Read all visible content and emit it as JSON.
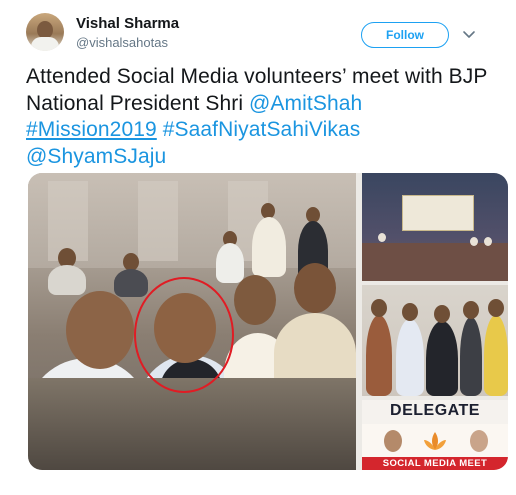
{
  "author": {
    "name": "Vishal Sharma",
    "handle": "@vishalsahotas",
    "avatar_icon": "profile-photo-icon"
  },
  "follow_button": {
    "label": "Follow"
  },
  "menu_caret": {
    "icon": "chevron-down-icon"
  },
  "tweet": {
    "text_plain": "Attended Social Media volunteers’ meet with BJP National President Shri ",
    "mention_1": "@AmitShah",
    "hashtag_1": "#Mission2019",
    "hashtag_2": "#SaafNiyatSahiVikas",
    "mention_2": "@ShyamSJaju"
  },
  "media": {
    "photos": [
      {
        "id": "group-selfie",
        "description_icon": "photo-icon"
      },
      {
        "id": "stage-event",
        "description_icon": "photo-icon"
      },
      {
        "id": "group-standing",
        "description_icon": "photo-icon"
      },
      {
        "id": "delegate-badge",
        "description_icon": "photo-icon"
      }
    ],
    "delegate_badge": {
      "title": "DELEGATE",
      "footer": "SOCIAL MEDIA MEET"
    }
  },
  "colors": {
    "link": "#1b95e0",
    "follow": "#1da1f2",
    "circle_mark": "#e01c24",
    "badge_red": "#d4262d"
  }
}
